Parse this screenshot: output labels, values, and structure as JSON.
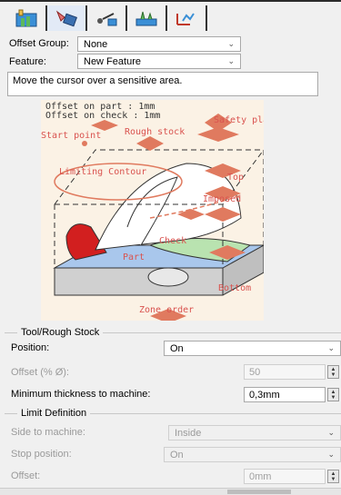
{
  "header": {
    "offset_group_label": "Offset Group:",
    "offset_group_value": "None",
    "feature_label": "Feature:",
    "feature_value": "New Feature",
    "hint": "Move the cursor over a sensitive area."
  },
  "toolbar": {
    "tabs": [
      {
        "icon": "geometry-tab-icon"
      },
      {
        "icon": "tool-tab-icon"
      },
      {
        "icon": "feeds-speeds-tab-icon"
      },
      {
        "icon": "macros-tab-icon"
      },
      {
        "icon": "strategy-tab-icon"
      }
    ]
  },
  "diagram": {
    "offset_on_part": "Offset on part : 1mm",
    "offset_on_check": "Offset on check : 1mm",
    "safety_plane": "Safety plan",
    "start_point": "Start point",
    "rough_stock": "Rough stock",
    "limiting_contour": "Limiting Contour",
    "top": "Top",
    "imposed": "Imposed",
    "check": "Check",
    "part": "Part",
    "bottom": "Bottom",
    "zone_order": "Zone order",
    "colors": {
      "background": "#fbf2e5",
      "sensitive": "#e07a5f",
      "label": "#d9534f"
    }
  },
  "tool_rough_stock": {
    "title": "Tool/Rough Stock",
    "position_label": "Position:",
    "position_value": "On",
    "offset_label": "Offset (% Ø):",
    "offset_value": "50",
    "min_thickness_label": "Minimum thickness to machine:",
    "min_thickness_value": "0,3mm"
  },
  "limit_definition": {
    "title": "Limit Definition",
    "side_label": "Side to machine:",
    "side_value": "Inside",
    "stop_label": "Stop position:",
    "stop_value": "On",
    "offset_label": "Offset:",
    "offset_value": "0mm"
  }
}
